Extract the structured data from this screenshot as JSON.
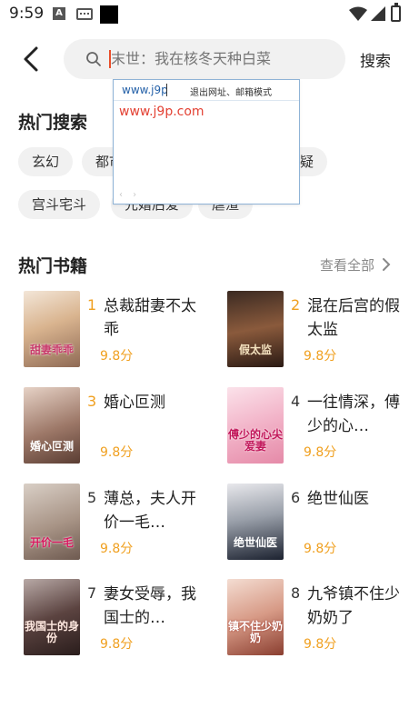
{
  "status_bar": {
    "time": "9:59",
    "icons": [
      "text-notification-icon",
      "keyboard-icon",
      "black-square-icon",
      "wifi-icon",
      "signal-icon",
      "battery-icon"
    ]
  },
  "header": {
    "search_placeholder": "末世：我在核冬天种白菜",
    "search_button": "搜索"
  },
  "hot_search": {
    "title": "热门搜索",
    "tags": [
      "玄幻",
      "都市",
      "悬疑",
      "宫斗宅斗",
      "先婚后爱",
      "虐渣"
    ]
  },
  "ime_popup": {
    "input_text": "www.j9p",
    "exit_label": "退出网址、邮箱模式",
    "candidate": "www.j9p.com",
    "nav": "‹ ›"
  },
  "hot_books": {
    "title": "热门书籍",
    "view_all": "查看全部",
    "books": [
      {
        "rank": "1",
        "title": "总裁甜妻不太乖",
        "score": "9.8分",
        "cover_text": "甜妻乖乖",
        "rank_color": "#f0a020"
      },
      {
        "rank": "2",
        "title": "混在后宫的假太监",
        "score": "9.8分",
        "cover_text": "假太监",
        "rank_color": "#f0a020"
      },
      {
        "rank": "3",
        "title": "婚心叵测",
        "score": "9.8分",
        "cover_text": "婚心叵测",
        "rank_color": "#f0a020"
      },
      {
        "rank": "4",
        "title": "一往情深，傅少的心…",
        "score": "9.8分",
        "cover_text": "傅少的心尖爱妻",
        "rank_color": "#333333"
      },
      {
        "rank": "5",
        "title": "薄总，夫人开价一毛…",
        "score": "9.8分",
        "cover_text": "开价一毛",
        "rank_color": "#333333"
      },
      {
        "rank": "6",
        "title": "绝世仙医",
        "score": "9.8分",
        "cover_text": "绝世仙医",
        "rank_color": "#333333"
      },
      {
        "rank": "7",
        "title": "妻女受辱，我国士的…",
        "score": "9.8分",
        "cover_text": "我国士的身份",
        "rank_color": "#333333"
      },
      {
        "rank": "8",
        "title": "九爷镇不住少奶奶了",
        "score": "9.8分",
        "cover_text": "镇不住少奶奶",
        "rank_color": "#333333"
      }
    ]
  },
  "colors": {
    "accent_orange": "#f0a020",
    "caret_red": "#e94d2a",
    "candidate_red": "#e34234",
    "tag_bg": "#f1f1f1"
  }
}
